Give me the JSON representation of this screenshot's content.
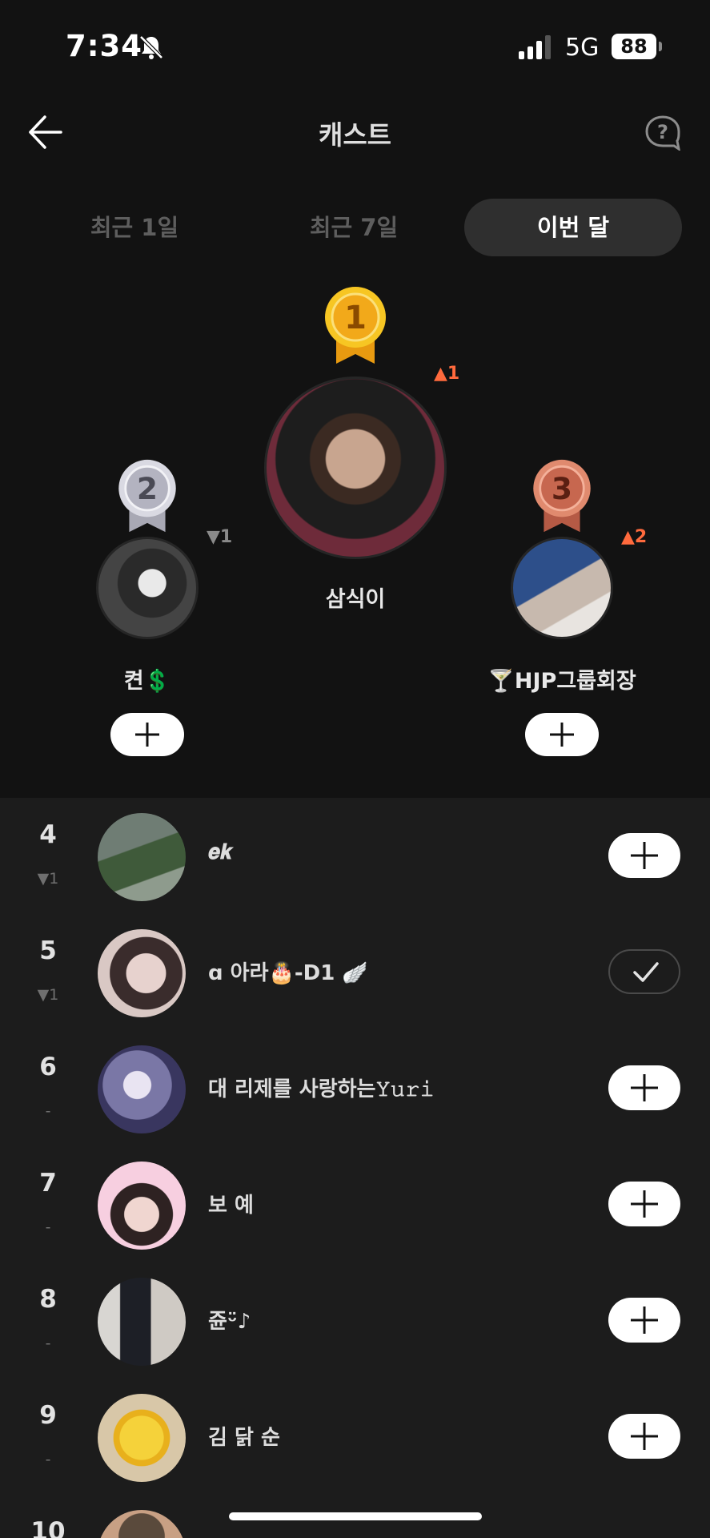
{
  "status_bar": {
    "time": "7:34",
    "network": "5G",
    "battery": "88"
  },
  "header": {
    "title": "캐스트"
  },
  "tabs": [
    {
      "label": "최근 1일",
      "active": false
    },
    {
      "label": "최근 7일",
      "active": false
    },
    {
      "label": "이번 달",
      "active": true
    }
  ],
  "podium": {
    "first": {
      "rank": "1",
      "name": "삼식이",
      "change": "▲1",
      "change_dir": "up"
    },
    "second": {
      "rank": "2",
      "name": "켠💲",
      "change": "▼1",
      "change_dir": "down"
    },
    "third": {
      "rank": "3",
      "name": "🍸HJP그룹회장",
      "change": "▲2",
      "change_dir": "up"
    }
  },
  "ranking": [
    {
      "rank": "4",
      "delta": "▼1",
      "name": "𝒆𝒌",
      "followed": false
    },
    {
      "rank": "5",
      "delta": "▼1",
      "name": "ɑ 아라🎂-D1 🪽",
      "followed": true
    },
    {
      "rank": "6",
      "delta": "-",
      "name": "대 리제를 사랑하는𝚈𝚞𝚛𝚒",
      "followed": false
    },
    {
      "rank": "7",
      "delta": "-",
      "name": "보 예",
      "followed": false
    },
    {
      "rank": "8",
      "delta": "-",
      "name": "쥰ᵕ̈♪",
      "followed": false
    },
    {
      "rank": "9",
      "delta": "-",
      "name": "김 닭 순",
      "followed": false
    },
    {
      "rank": "10",
      "delta": "",
      "name": "",
      "followed": false
    }
  ],
  "colors": {
    "background": "#121212",
    "list_background": "#1c1c1c",
    "up_arrow": "#ff6a3d",
    "gold": "#f2b21a",
    "silver": "#b9b9c4",
    "bronze": "#c9715a"
  },
  "icons": {
    "back": "back-arrow-icon",
    "help": "help-bubble-icon",
    "bell": "bell-slash-icon",
    "follow": "plus-icon",
    "followed": "check-icon"
  }
}
